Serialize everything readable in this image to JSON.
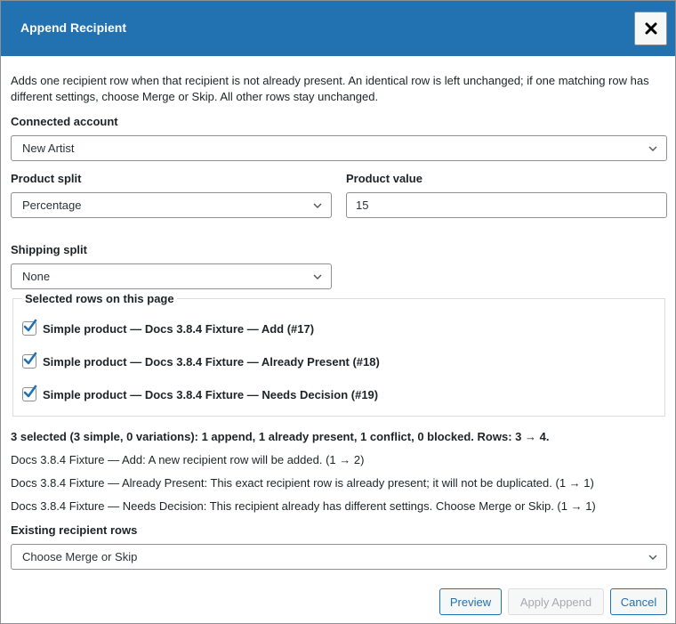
{
  "dialog": {
    "title": "Append Recipient",
    "close_icon": "close-icon",
    "description": "Adds one recipient row when that recipient is not already present. An identical row is left unchanged; if one matching row has different settings, choose Merge or Skip. All other rows stay unchanged."
  },
  "connected_account": {
    "label": "Connected account",
    "value": "New Artist"
  },
  "product_split": {
    "label": "Product split",
    "value": "Percentage"
  },
  "product_value": {
    "label": "Product value",
    "value": "15"
  },
  "shipping_split": {
    "label": "Shipping split",
    "value": "None"
  },
  "selected_rows": {
    "legend": "Selected rows on this page",
    "items": [
      {
        "label": "Simple product — Docs 3.8.4 Fixture — Add (#17)",
        "checked": true
      },
      {
        "label": "Simple product — Docs 3.8.4 Fixture — Already Present (#18)",
        "checked": true
      },
      {
        "label": "Simple product — Docs 3.8.4 Fixture — Needs Decision (#19)",
        "checked": true
      }
    ]
  },
  "summary": "3 selected (3 simple, 0 variations): 1 append, 1 already present, 1 conflict, 0 blocked. Rows: 3 → 4.",
  "notes": [
    "Docs 3.8.4 Fixture — Add: A new recipient row will be added. (1 → 2)",
    "Docs 3.8.4 Fixture — Already Present: This exact recipient row is already present; it will not be duplicated. (1 → 1)",
    "Docs 3.8.4 Fixture — Needs Decision: This recipient already has different settings. Choose Merge or Skip. (1 → 1)"
  ],
  "existing_rows": {
    "label": "Existing recipient rows",
    "value": "Choose Merge or Skip"
  },
  "buttons": {
    "preview": "Preview",
    "apply": "Apply Append",
    "cancel": "Cancel"
  },
  "colors": {
    "header": "#2271b1",
    "accent": "#2271b1",
    "check": "#2271b1",
    "disabled_text": "#a7aaad"
  }
}
